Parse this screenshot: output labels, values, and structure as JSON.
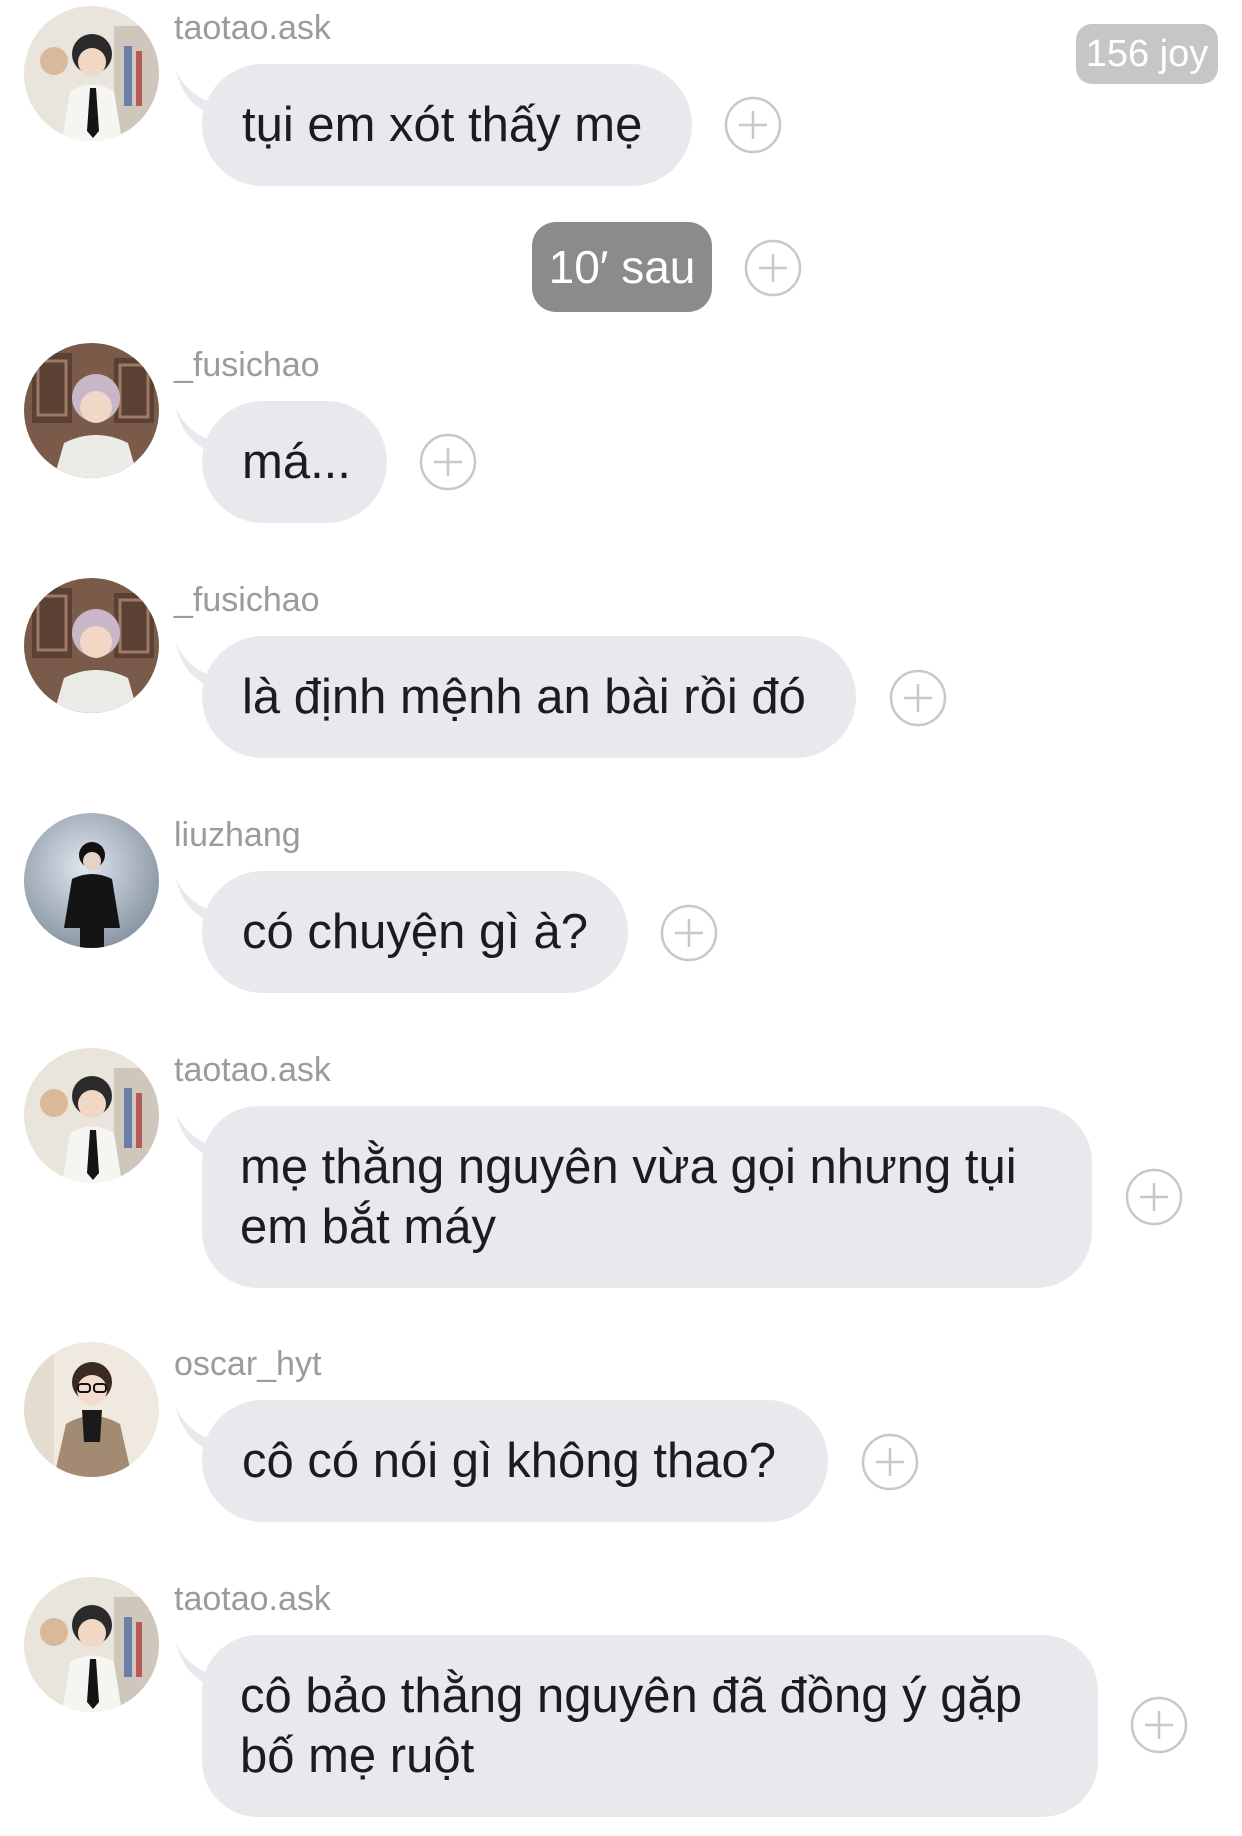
{
  "header": {
    "badge_text": "156 joy"
  },
  "separator": {
    "label": "10′ sau"
  },
  "messages": [
    {
      "username": "taotao.ask",
      "avatar": "avatar-taotao",
      "text": "tụi em xót thấy mẹ"
    },
    {
      "username": "_fusichao",
      "avatar": "avatar-fusichao",
      "text": "má..."
    },
    {
      "username": "_fusichao",
      "avatar": "avatar-fusichao",
      "text": "là định mệnh an bài rồi đó"
    },
    {
      "username": "liuzhang",
      "avatar": "avatar-liuzhang",
      "text": "có chuyện gì à?"
    },
    {
      "username": "taotao.ask",
      "avatar": "avatar-taotao",
      "text": "mẹ thằng nguyên vừa gọi nhưng tụi em bắt máy"
    },
    {
      "username": "oscar_hyt",
      "avatar": "avatar-oscar",
      "text": "cô có nói gì không thao?"
    },
    {
      "username": "taotao.ask",
      "avatar": "avatar-taotao",
      "text": "cô bảo thằng nguyên đã đồng ý gặp bố mẹ ruột"
    }
  ],
  "icons": {
    "react": "plus-circle-icon"
  },
  "colors": {
    "bubble": "#e8e9ed",
    "badge": "#c6c6c8",
    "timestamp": "#8b8b8d",
    "username": "#9a9a9f"
  }
}
